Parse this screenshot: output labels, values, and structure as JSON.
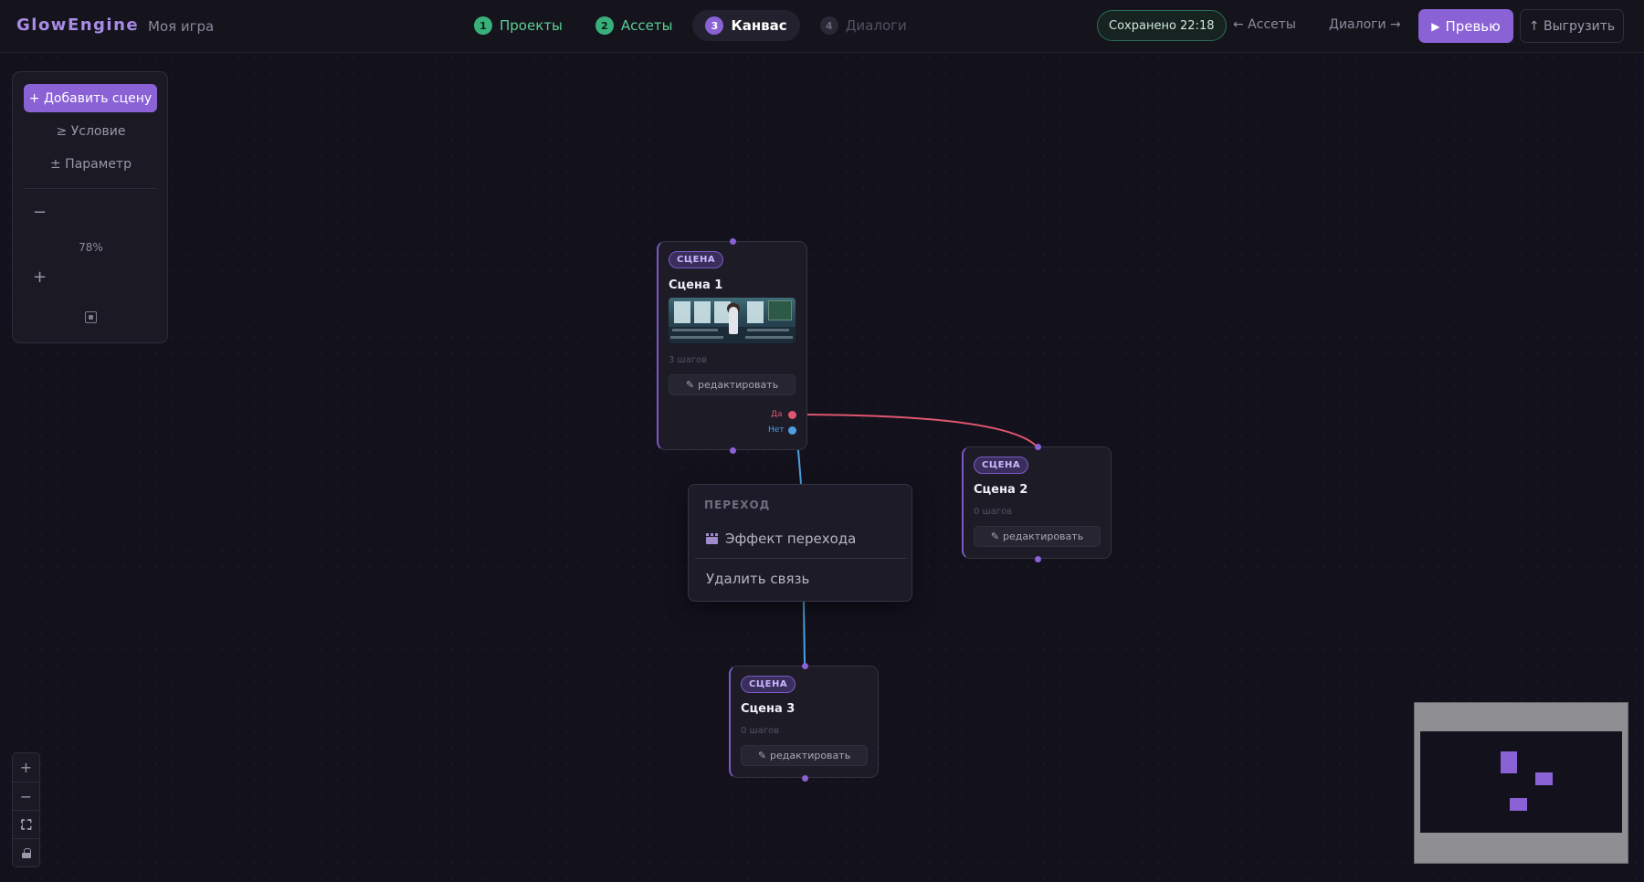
{
  "app": {
    "logo": "GlowEngine",
    "separator": "·",
    "project_name": "Моя игра"
  },
  "steps": [
    {
      "num": "1",
      "label": "Проекты",
      "state": "done"
    },
    {
      "num": "2",
      "label": "Ассеты",
      "state": "done"
    },
    {
      "num": "3",
      "label": "Канвас",
      "state": "active"
    },
    {
      "num": "4",
      "label": "Диалоги",
      "state": "pending"
    }
  ],
  "header": {
    "saved": "Сохранено 22:18",
    "back_link": "← Ассеты",
    "next_link": "Диалоги →",
    "preview_icon": "▶",
    "preview_label": "Превью",
    "export_label": "↑ Выгрузить"
  },
  "toolbox": {
    "add_scene": "+ Добавить сцену",
    "condition": "≥ Условие",
    "parameter": "± Параметр",
    "zoom_out": "−",
    "zoom_level": "78%",
    "zoom_in": "+"
  },
  "nodes": [
    {
      "badge": "СЦЕНА",
      "title": "Сцена 1",
      "steps": "3 шагов",
      "edit": "редактировать",
      "outputs": [
        {
          "label": "Да",
          "color": "#e0566f"
        },
        {
          "label": "Нет",
          "color": "#4e9fe0"
        }
      ]
    },
    {
      "badge": "СЦЕНА",
      "title": "Сцена 2",
      "steps": "0 шагов",
      "edit": "редактировать"
    },
    {
      "badge": "СЦЕНА",
      "title": "Сцена 3",
      "steps": "0 шагов",
      "edit": "редактировать"
    }
  ],
  "edit_icon": "✎",
  "context_menu": {
    "title": "ПЕРЕХОД",
    "transition_effect": "Эффект перехода",
    "delete_link": "Удалить связь"
  },
  "controls": {
    "zoom_in": "+",
    "zoom_out": "−"
  },
  "colors": {
    "accent": "#8a62d6",
    "success": "#38b07a",
    "edge_yes": "#e0566f",
    "edge_no": "#4e9fe0"
  }
}
